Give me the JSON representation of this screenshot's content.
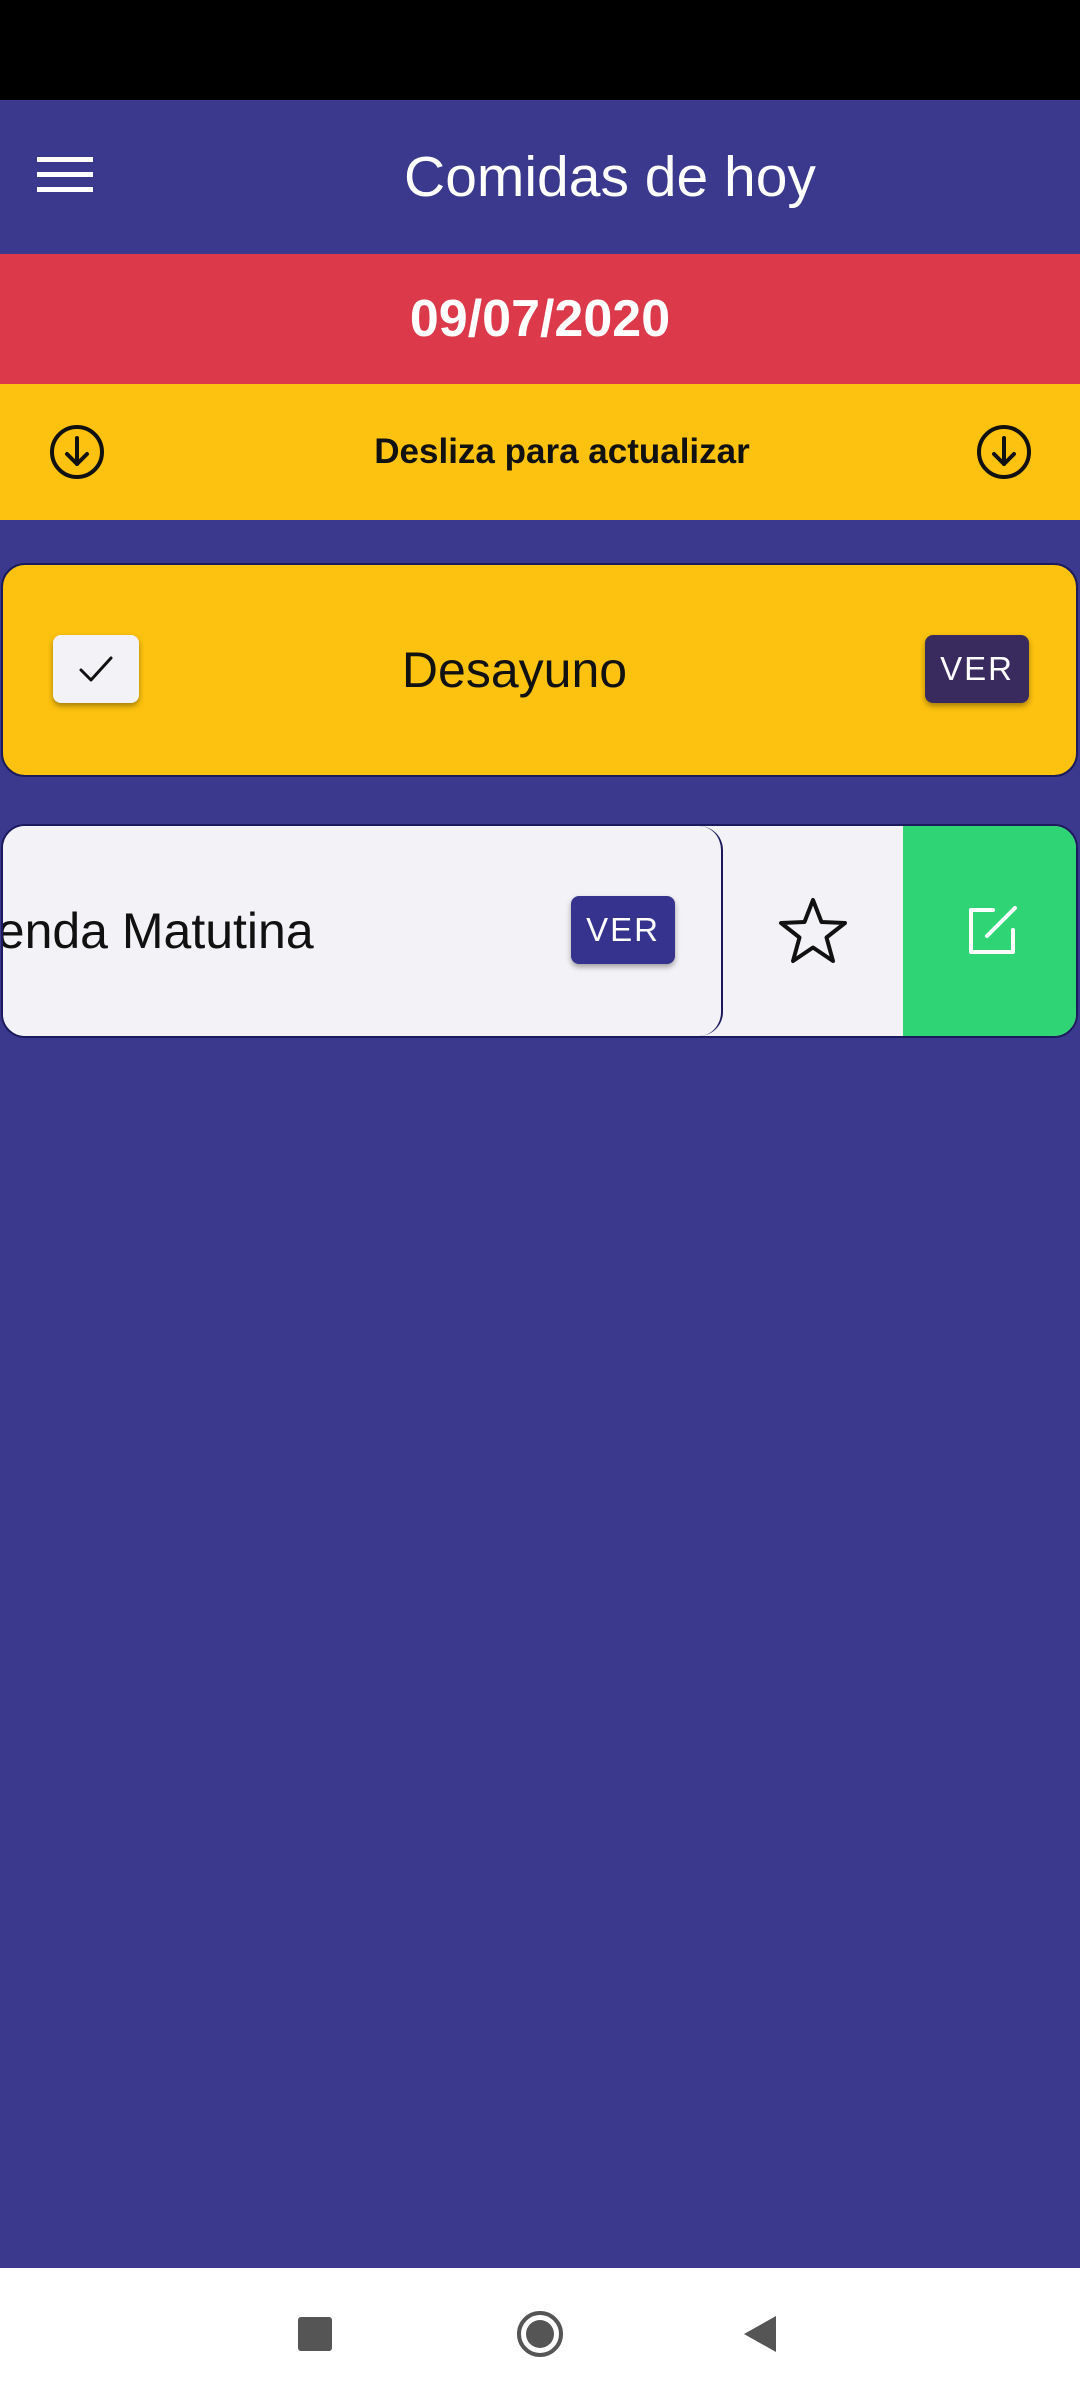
{
  "app_bar": {
    "title": "Comidas de hoy",
    "menu_icon": "hamburger-menu-icon"
  },
  "date_banner": {
    "date": "09/07/2020"
  },
  "refresh_banner": {
    "text": "Desliza para actualizar",
    "icon": "arrow-down-circle-icon"
  },
  "meals": [
    {
      "name": "Desayuno",
      "checked": true,
      "view_label": "VER"
    },
    {
      "name": "Merienda Matutina",
      "visible_name": "rienda Matutina",
      "view_label": "VER",
      "swipe_actions": [
        "star-icon",
        "edit-icon"
      ]
    }
  ],
  "colors": {
    "primary": "#3a398e",
    "date_banner": "#dc3a4b",
    "accent_yellow": "#fdc20f",
    "edit_green": "#2fd575",
    "card_light": "#f3f3f7"
  },
  "system_nav": {
    "buttons": [
      "recents-icon",
      "home-icon",
      "back-icon"
    ]
  }
}
